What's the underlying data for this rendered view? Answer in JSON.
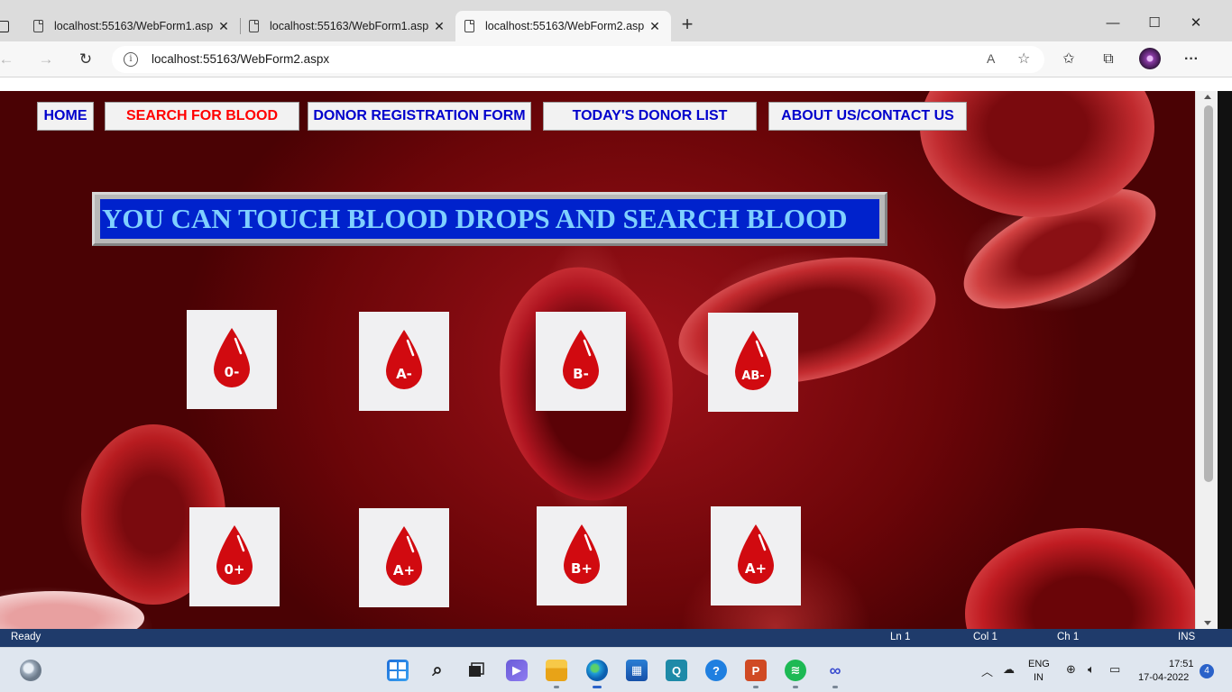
{
  "browser": {
    "tabs": [
      {
        "title": "localhost:55163/WebForm1.aspx",
        "close": "✕"
      },
      {
        "title": "localhost:55163/WebForm1.aspx",
        "close": "✕"
      },
      {
        "title": "localhost:55163/WebForm2.aspx",
        "close": "✕",
        "active": true
      }
    ],
    "new_tab": "+",
    "window": {
      "minimize": "—",
      "maximize": "☐",
      "close": "✕"
    },
    "address": "localhost:55163/WebForm2.aspx",
    "nav": {
      "back": "←",
      "forward": "→",
      "refresh": "↻"
    },
    "toolbar_icons": {
      "read_aloud": "A",
      "add_favorite": "☆",
      "favorites": "✩",
      "collections": "⧉",
      "more": "···"
    }
  },
  "page": {
    "nav_buttons": [
      {
        "label": "HOME"
      },
      {
        "label": "SEARCH FOR BLOOD",
        "current": true
      },
      {
        "label": "DONOR REGISTRATION FORM"
      },
      {
        "label": "TODAY'S DONOR LIST"
      },
      {
        "label": "ABOUT US/CONTACT US"
      }
    ],
    "banner": "YOU CAN TOUCH BLOOD DROPS AND SEARCH BLOOD",
    "blood_groups_row1": [
      "0-",
      "A-",
      "B-",
      "AB-"
    ],
    "blood_groups_row2": [
      "0+",
      "A+",
      "B+",
      "A+"
    ],
    "colors": {
      "nav_text": "#0000cc",
      "nav_current": "#ff0000",
      "banner_bg": "#0022cc",
      "banner_text": "#7fd0ff",
      "drop": "#d10a10"
    }
  },
  "statusbar": {
    "left": "Ready",
    "ln": "Ln 1",
    "col": "Col 1",
    "ch": "Ch 1",
    "mode": "INS"
  },
  "taskbar": {
    "language": "ENG",
    "region": "IN",
    "time": "17:51",
    "date": "17-04-2022",
    "notifications": "4",
    "apps": [
      "start",
      "search",
      "task-view",
      "chat",
      "file-explorer",
      "edge",
      "store",
      "app-q",
      "help",
      "powerpoint",
      "spotify",
      "link-app"
    ]
  }
}
